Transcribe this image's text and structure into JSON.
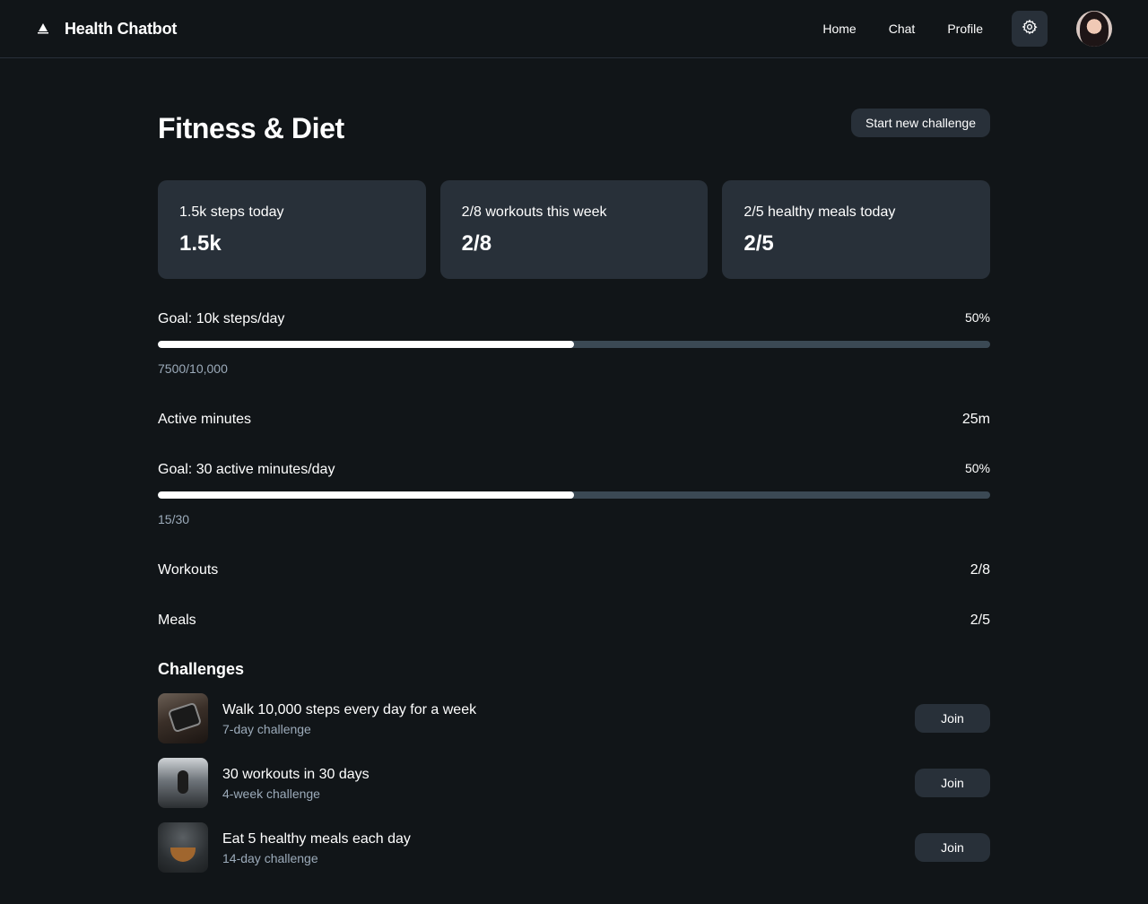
{
  "app": {
    "title": "Health Chatbot"
  },
  "nav": {
    "items": [
      "Home",
      "Chat",
      "Profile"
    ]
  },
  "page": {
    "title": "Fitness & Diet",
    "new_challenge_label": "Start new challenge"
  },
  "cards": [
    {
      "label": "1.5k steps today",
      "value": "1.5k"
    },
    {
      "label": "2/8 workouts this week",
      "value": "2/8"
    },
    {
      "label": "2/5 healthy meals today",
      "value": "2/5"
    }
  ],
  "steps_goal": {
    "label": "Goal: 10k steps/day",
    "percent_text": "50%",
    "fill_fraction": 0.5,
    "detail": "7500/10,000"
  },
  "active_minutes": {
    "label": "Active minutes",
    "value": "25m"
  },
  "minutes_goal": {
    "label": "Goal: 30 active minutes/day",
    "percent_text": "50%",
    "fill_fraction": 0.5,
    "detail": "15/30"
  },
  "workouts": {
    "label": "Workouts",
    "value": "2/8"
  },
  "meals": {
    "label": "Meals",
    "value": "2/5"
  },
  "challenges": {
    "title": "Challenges",
    "items": [
      {
        "title": "Walk 10,000 steps every day for a week",
        "subtitle": "7-day challenge",
        "button": "Join",
        "thumb": "smartwatch-image"
      },
      {
        "title": "30 workouts in 30 days",
        "subtitle": "4-week challenge",
        "button": "Join",
        "thumb": "gym-workout-image"
      },
      {
        "title": "Eat 5 healthy meals each day",
        "subtitle": "14-day challenge",
        "button": "Join",
        "thumb": "salad-bowl-image"
      }
    ]
  },
  "icons": {
    "brand": "logo-icon",
    "settings": "gear-icon",
    "avatar": "user-avatar"
  },
  "colors": {
    "background": "#111518",
    "surface": "#283039",
    "track": "#3b4954",
    "muted_text": "#9cabba",
    "fill": "#ffffff"
  }
}
